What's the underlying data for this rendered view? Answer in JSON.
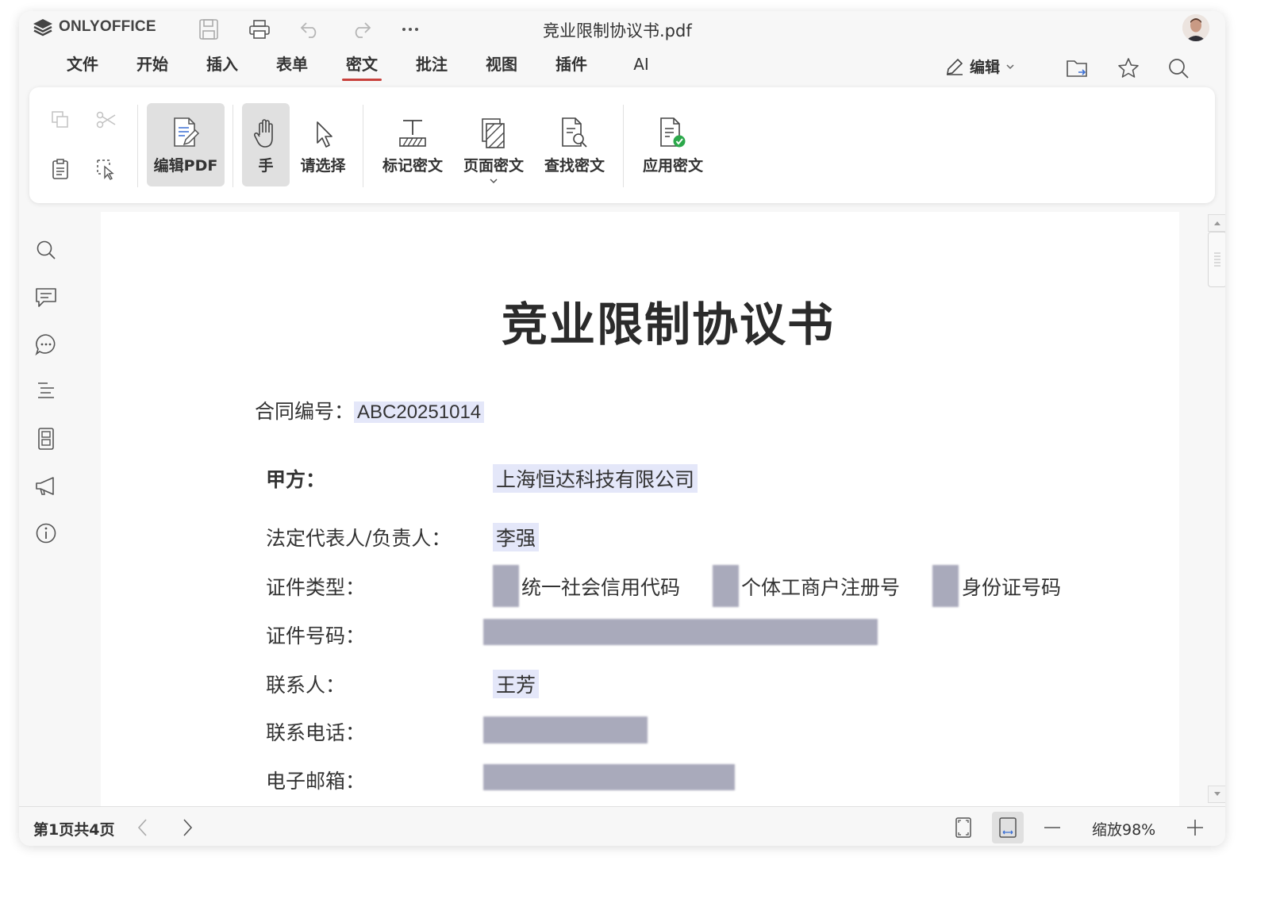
{
  "app": {
    "logo_text": "ONLYOFFICE"
  },
  "document": {
    "file_name": "竞业限制协议书.pdf"
  },
  "quick_access": [
    "save-icon",
    "print-icon",
    "undo-icon",
    "redo-icon",
    "more-icon"
  ],
  "menu": {
    "tabs": [
      {
        "label": "文件"
      },
      {
        "label": "开始"
      },
      {
        "label": "插入"
      },
      {
        "label": "表单"
      },
      {
        "label": "密文",
        "active": true
      },
      {
        "label": "批注"
      },
      {
        "label": "视图"
      },
      {
        "label": "插件"
      },
      {
        "label": "AI"
      }
    ],
    "mode_label": "编辑"
  },
  "ribbon": {
    "edit_pdf": "编辑PDF",
    "hand": "手",
    "select": "请选择",
    "mark_redaction": "标记密文",
    "page_redaction": "页面密文",
    "find_redaction": "查找密文",
    "apply_redaction": "应用密文"
  },
  "page": {
    "heading": "竞业限制协议书",
    "contract_no_label": "合同编号：",
    "contract_no_value": "ABC20251014",
    "party_a_label": "甲方：",
    "party_a_value": "上海恒达科技有限公司",
    "legal_rep_label": "法定代表人/负责人：",
    "legal_rep_value": "李强",
    "id_type_label": "证件类型：",
    "id_type_options": [
      "统一社会信用代码",
      "个体工商户注册号",
      "身份证号码"
    ],
    "id_number_label": "证件号码：",
    "contact_label": "联系人：",
    "contact_value": "王芳",
    "phone_label": "联系电话：",
    "email_label": "电子邮箱："
  },
  "status": {
    "page_indicator": "第1页共4页",
    "zoom_label": "缩放98%"
  },
  "colors": {
    "accent": "#c8413c",
    "highlight": "#e4e7f9",
    "redaction": "#a9aabb",
    "apply_check": "#2ba84a"
  }
}
